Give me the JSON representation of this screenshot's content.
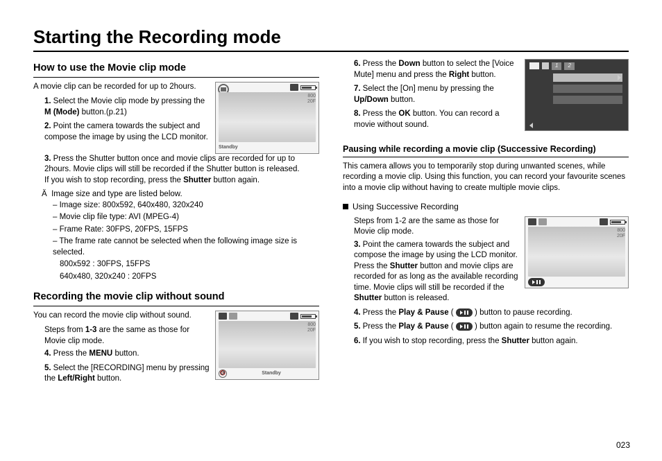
{
  "page": {
    "title": "Starting the Recording mode",
    "number": "023"
  },
  "left": {
    "section1": {
      "title": "How to use the Movie clip mode",
      "intro": "A movie clip can be recorded for up to 2hours.",
      "step1_pre": "Select the Movie clip mode by pressing the ",
      "step1_bold": "M (Mode)",
      "step1_post": " button.(p.21)",
      "step2": "Point the camera towards the subject and compose the image by using the LCD monitor.",
      "step3_pre": "Press the Shutter button once and movie clips are recorded for up to 2hours. Movie clips will still be recorded if the Shutter button is released.\nIf you wish to stop recording, press the ",
      "step3_bold": "Shutter",
      "step3_post": " button again.",
      "star": "Image size and type are listed below.",
      "bullet1": "– Image size: 800x592, 640x480, 320x240",
      "bullet2": "– Movie clip file type: AVI (MPEG-4)",
      "bullet3": "– Frame Rate: 30FPS, 20FPS, 15FPS",
      "bullet4": "– The frame rate cannot be selected when the following image size is selected.",
      "bullet4a": "800x592 : 30FPS, 15FPS",
      "bullet4b": "640x480, 320x240 : 20FPS"
    },
    "section2": {
      "title": "Recording the movie clip without sound",
      "intro": "You can record the movie clip without sound.",
      "steps_same_pre": "Steps from ",
      "steps_same_bold": "1-3",
      "steps_same_post": " are the same as those for Movie clip mode.",
      "step4_pre": "Press the ",
      "step4_bold": "MENU",
      "step4_post": " button.",
      "step5_pre": "Select the [RECORDING] menu by pressing the ",
      "step5_bold": "Left/Right",
      "step5_post": " button."
    }
  },
  "right": {
    "step6_pre": "Press the ",
    "step6_bold1": "Down",
    "step6_mid": " button to select the [Voice Mute] menu and press the ",
    "step6_bold2": "Right",
    "step6_post": " button.",
    "step7_pre": "Select the [On] menu by pressing the ",
    "step7_bold": "Up/Down",
    "step7_post": " button.",
    "step8_pre": "Press the ",
    "step8_bold": "OK",
    "step8_post": " button. You can record a movie without sound.",
    "section3": {
      "title": "Pausing while recording a movie clip (Successive Recording)",
      "intro": "This camera allows you to temporarily stop during unwanted scenes, while recording a movie clip. Using this function, you can record your favourite scenes into a movie clip without having to create multiple movie clips.",
      "sub": "Using Successive Recording",
      "steps_same": "Steps from 1-2 are the same as those for Movie clip mode.",
      "step3_pre": "Point the camera towards the subject and compose the image by using the LCD monitor. Press the ",
      "step3_b1": "Shutter",
      "step3_mid": " button and movie clips are recorded for as long as the available recording time. Movie clips will still be recorded if the ",
      "step3_b2": "Shutter",
      "step3_post": " button is released.",
      "step4_pre": "Press the ",
      "step4_bold": "Play & Pause",
      "step4_post": " button to pause recording.",
      "step5_pre": "Press the ",
      "step5_bold": "Play & Pause",
      "step5_post": " button again to resume the recording.",
      "step6_pre": "If you wish to stop recording, press the ",
      "step6_bold": "Shutter",
      "step6_post": " button again."
    }
  },
  "lcd": {
    "standby": "Standby",
    "res1": "800",
    "res2": "20F",
    "menu_tab1": "1",
    "menu_tab2": "2"
  }
}
